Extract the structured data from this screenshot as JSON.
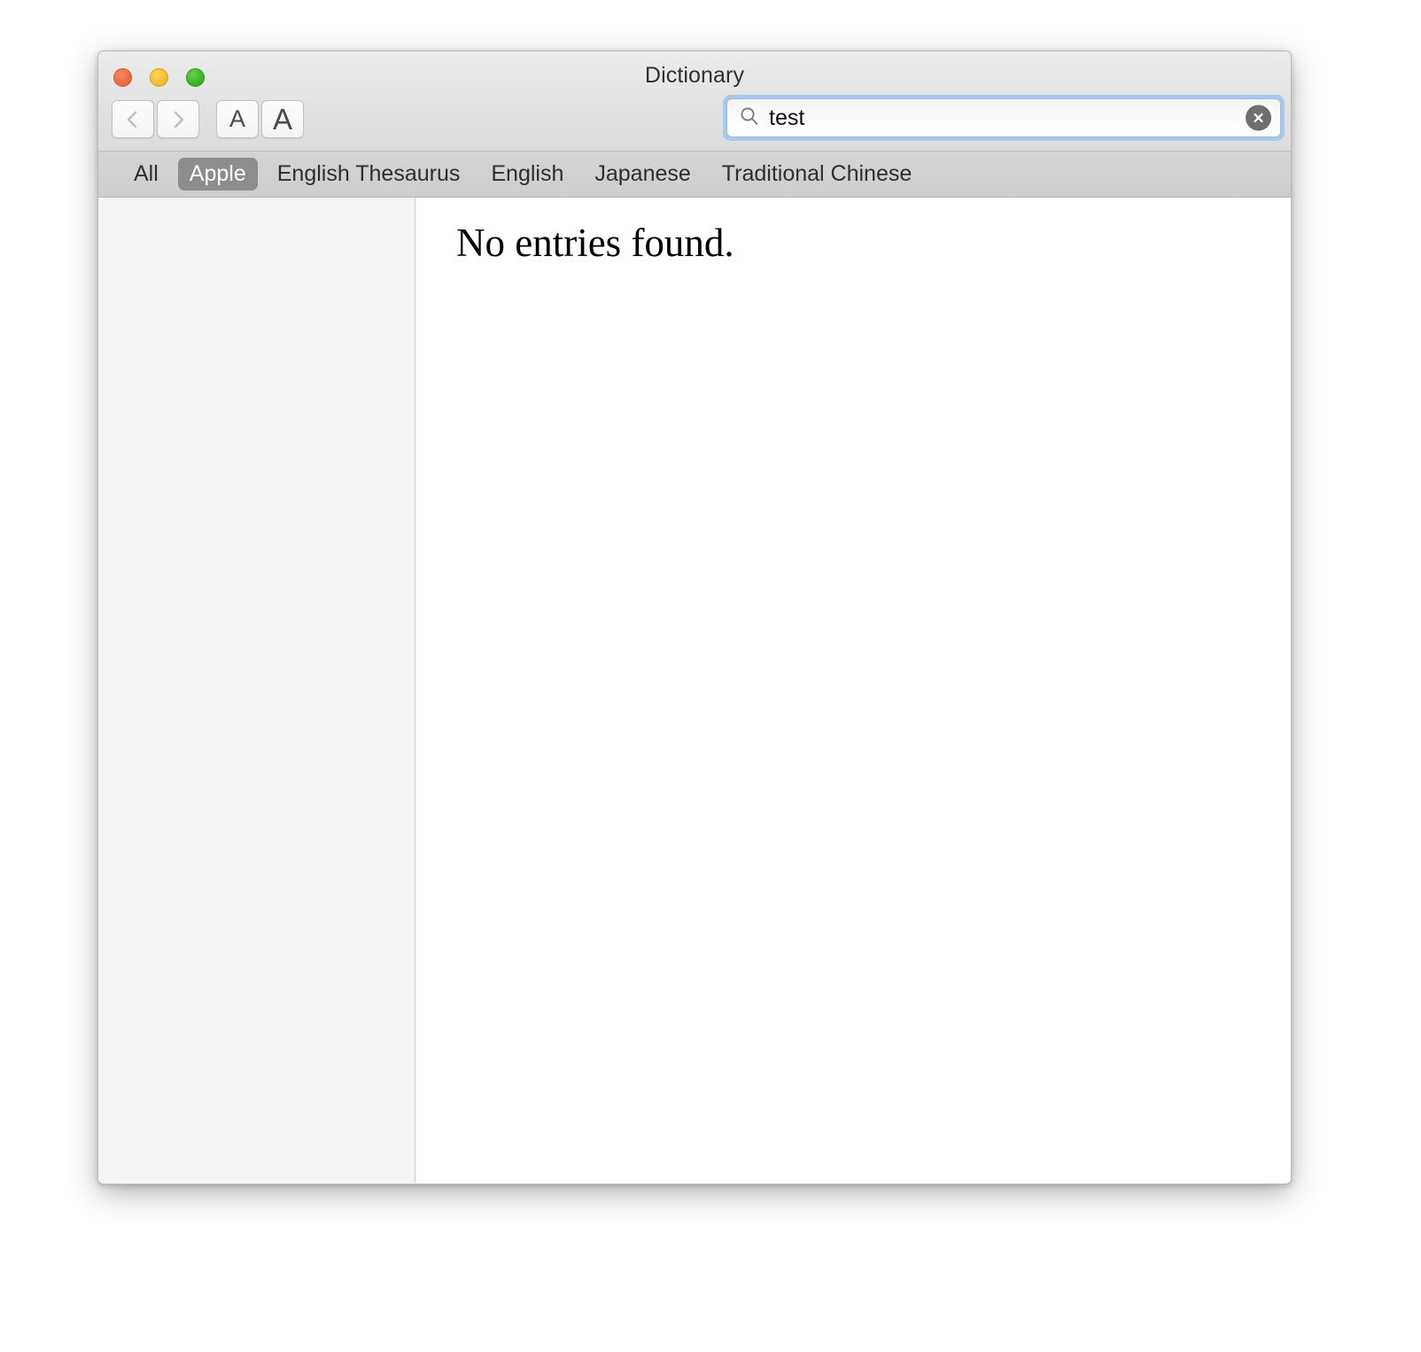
{
  "window": {
    "title": "Dictionary",
    "traffic_lights": [
      {
        "name": "close",
        "color": "#ed6a45"
      },
      {
        "name": "minimize",
        "color": "#f6bc2f"
      },
      {
        "name": "zoom",
        "color": "#3cb321"
      }
    ]
  },
  "toolbar": {
    "back_label": "",
    "forward_label": "",
    "font_smaller_label": "A",
    "font_larger_label": "A"
  },
  "search": {
    "icon": "search-icon",
    "value": "test",
    "placeholder": "Search",
    "clear_icon": "clear-circle-icon",
    "focus_ring_color": "#a9c9ec"
  },
  "tabs": [
    {
      "label": "All",
      "selected": false
    },
    {
      "label": "Apple",
      "selected": true
    },
    {
      "label": "English Thesaurus",
      "selected": false
    },
    {
      "label": "English",
      "selected": false
    },
    {
      "label": "Japanese",
      "selected": false
    },
    {
      "label": "Traditional Chinese",
      "selected": false
    }
  ],
  "sidebar": {
    "items": []
  },
  "content": {
    "message": "No entries found."
  },
  "colors": {
    "selected_tab_background": "#8d8d8d",
    "tabbar_background": "#d1d1d1",
    "sidebar_background": "#f4f4f4",
    "content_background": "#ffffff"
  }
}
